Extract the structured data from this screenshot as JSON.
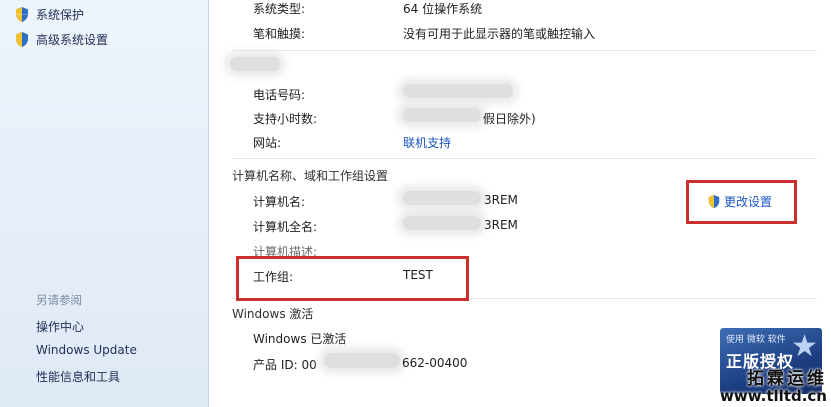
{
  "sidebar": {
    "tasks": [
      {
        "label": "系统保护",
        "icon": "shield-icon"
      },
      {
        "label": "高级系统设置",
        "icon": "shield-icon"
      }
    ],
    "see_also": {
      "heading": "另请参阅",
      "links": [
        "操作中心",
        "Windows Update",
        "性能信息和工具"
      ]
    }
  },
  "system": {
    "type_label": "系统类型:",
    "type_value": "64 位操作系统",
    "pen_label": "笔和触摸:",
    "pen_value": "没有可用于此显示器的笔或触控输入"
  },
  "support": {
    "phone_label": "电话号码:",
    "hours_label": "支持小时数:",
    "hours_value_visible": "假日除外)",
    "website_label": "网站:",
    "website_link": "联机支持"
  },
  "computer": {
    "section_title": "计算机名称、域和工作组设置",
    "name_label": "计算机名:",
    "name_value_visible": "3REM",
    "fullname_label": "计算机全名:",
    "fullname_value_visible": "3REM",
    "desc_label": "计算机描述:",
    "workgroup_label": "工作组:",
    "workgroup_value": "TEST",
    "change_settings": "更改设置"
  },
  "activation": {
    "section_title": "Windows 激活",
    "status": "Windows 已激活",
    "product_id_label": "产品 ID: 00",
    "product_id_visible": "662-00400"
  },
  "genuine_badge": {
    "top_text": "使用 微软 软件",
    "main_text": "正版授权"
  },
  "watermark": {
    "line1": "拓霖运维",
    "line2": "www.tlltd.cn"
  },
  "colors": {
    "highlight_box": "#c9302c",
    "link": "#1a56c4"
  }
}
